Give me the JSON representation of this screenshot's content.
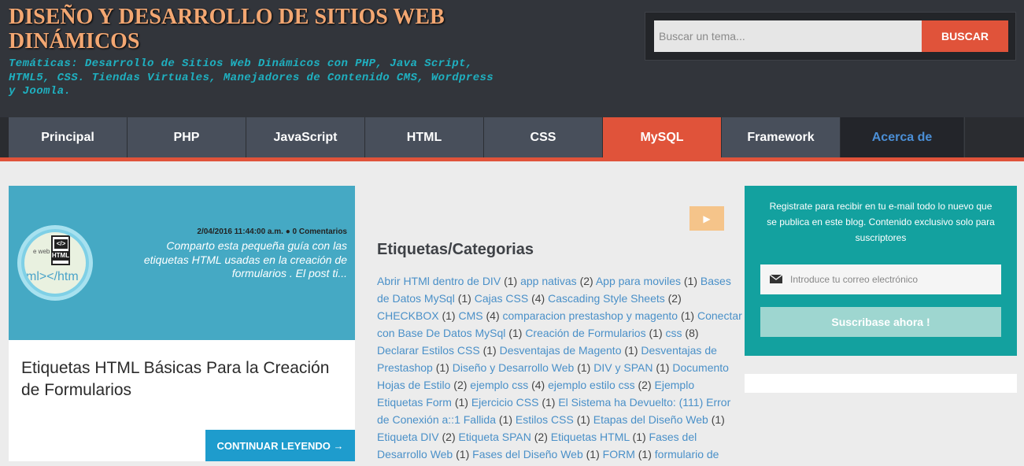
{
  "header": {
    "title": "DISEÑO Y DESARROLLO DE SITIOS WEB DINÁMICOS",
    "description": "Temáticas: Desarrollo de Sitios Web Dinámicos con PHP, Java Script, HTML5, CSS. Tiendas Virtuales, Manejadores de Contenido CMS, Wordpress y Joomla.",
    "search": {
      "placeholder": "Buscar un tema...",
      "button_label": "BUSCAR"
    }
  },
  "nav": {
    "items": [
      {
        "label": "Principal"
      },
      {
        "label": "PHP"
      },
      {
        "label": "JavaScript"
      },
      {
        "label": "HTML"
      },
      {
        "label": "CSS"
      },
      {
        "label": "MySQL"
      },
      {
        "label": "Framework"
      },
      {
        "label": "Acerca de"
      }
    ],
    "active": "MySQL",
    "colors": {
      "accent": "#e0533a",
      "item_bg": "#484f5b",
      "header_bg": "#32353b"
    }
  },
  "post": {
    "meta": "2/04/2016 11:44:00 a.m. ● 0 Comentarios",
    "excerpt": "Comparto esta pequeña guía con las etiquetas HTML usadas en la creación de formularios . El post ti...",
    "title": "Etiquetas HTML Básicas Para la Creación de Formularios",
    "continue_label": "CONTINUAR LEYENDO →",
    "thumb": {
      "web_text": "e web",
      "file_top": "</>",
      "file_label": "HTML",
      "code_text": "ml></htm"
    }
  },
  "play_button": {
    "icon": "play-icon",
    "glyph": "▶"
  },
  "tags": {
    "title": "Etiquetas/Categorias",
    "items": [
      {
        "name": "Abrir HTMl dentro de DIV",
        "count": "(1)"
      },
      {
        "name": "app nativas",
        "count": "(2)"
      },
      {
        "name": "App para moviles",
        "count": "(1)"
      },
      {
        "name": "Bases de Datos MySql",
        "count": "(1)"
      },
      {
        "name": "Cajas CSS",
        "count": "(4)"
      },
      {
        "name": "Cascading Style Sheets",
        "count": "(2)"
      },
      {
        "name": "CHECKBOX",
        "count": "(1)"
      },
      {
        "name": "CMS",
        "count": "(4)"
      },
      {
        "name": "comparacion prestashop y magento",
        "count": "(1)"
      },
      {
        "name": "Conectar con Base De Datos MySql",
        "count": "(1)"
      },
      {
        "name": "Creación de Formularios",
        "count": "(1)"
      },
      {
        "name": "css",
        "count": "(8)"
      },
      {
        "name": "Declarar Estilos CSS",
        "count": "(1)"
      },
      {
        "name": "Desventajas de Magento",
        "count": "(1)"
      },
      {
        "name": "Desventajas de Prestashop",
        "count": "(1)"
      },
      {
        "name": "Diseño y Desarrollo Web",
        "count": "(1)"
      },
      {
        "name": "DIV y SPAN",
        "count": "(1)"
      },
      {
        "name": "Documento Hojas de Estilo",
        "count": "(2)"
      },
      {
        "name": "ejemplo css",
        "count": "(4)"
      },
      {
        "name": "ejemplo estilo css",
        "count": "(2)"
      },
      {
        "name": "Ejemplo Etiquetas Form",
        "count": "(1)"
      },
      {
        "name": "Ejercicio CSS",
        "count": "(1)"
      },
      {
        "name": "El Sistema ha Devuelto: (111) Error de Conexión a::1 Fallida",
        "count": "(1)"
      },
      {
        "name": "Estilos CSS",
        "count": "(1)"
      },
      {
        "name": "Etapas del Diseño Web",
        "count": "(1)"
      },
      {
        "name": "Etiqueta DIV",
        "count": "(2)"
      },
      {
        "name": "Etiqueta SPAN",
        "count": "(2)"
      },
      {
        "name": "Etiquetas HTML",
        "count": "(1)"
      },
      {
        "name": "Fases del Desarrollo Web",
        "count": "(1)"
      },
      {
        "name": "Fases del Diseño Web",
        "count": "(1)"
      },
      {
        "name": "FORM",
        "count": "(1)"
      },
      {
        "name": "formulario de",
        "count": ""
      }
    ]
  },
  "subscribe": {
    "text": "Registrate para recibir en tu e-mail todo lo nuevo que se publica en este blog. Contenido exclusivo solo para suscriptores",
    "email_placeholder": "Introduce tu correo electrónico",
    "button_label": "Suscribase ahora !"
  }
}
